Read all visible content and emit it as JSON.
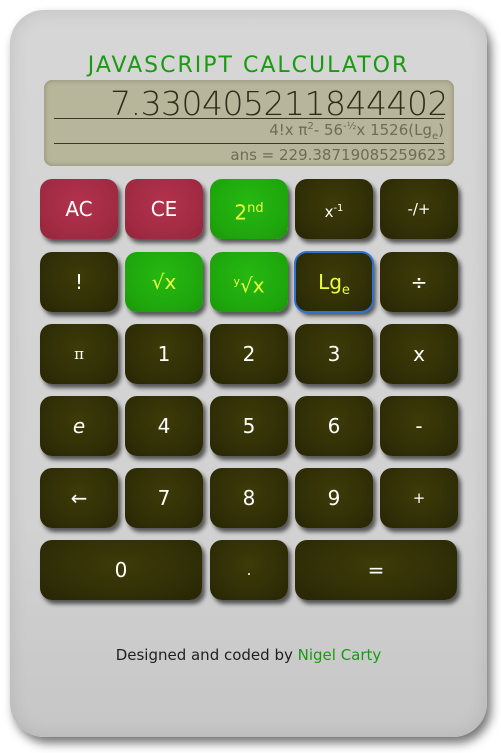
{
  "title": "Javascript Calculator",
  "display": {
    "value": "7.330405211844402",
    "expression": "4!x π2- 56-½x 1526(Lge)",
    "expr_parts": [
      "4!x π",
      "2",
      "- 56",
      "-½",
      "x 1526(Lg",
      "e",
      ")"
    ],
    "answer": "ans = 229.38719085259623"
  },
  "buttons": {
    "ac": "AC",
    "ce": "CE",
    "second": "2",
    "second_sup": "nd",
    "inverse": "x",
    "inverse_sup": "-1",
    "negate": "-/+",
    "factorial": "!",
    "sqrt": "√x",
    "yroot_sup": "y",
    "yroot": "√x",
    "log": "Lg",
    "log_sub": "e",
    "divide": "÷",
    "pi": "π",
    "one": "1",
    "two": "2",
    "three": "3",
    "multiply": "x",
    "e": "e",
    "four": "4",
    "five": "5",
    "six": "6",
    "minus": "-",
    "back": "←",
    "seven": "7",
    "eight": "8",
    "nine": "9",
    "plus": "+",
    "zero": "0",
    "dot": ".",
    "equals": "="
  },
  "footer": {
    "text": "Designed and coded by ",
    "author": "Nigel Carty"
  },
  "colors": {
    "accent_green": "#1a9a10",
    "button_dark": "#2f2d06",
    "button_red": "#a02a42",
    "button_green": "#1ea60c",
    "highlight": "#e9ff3a"
  }
}
